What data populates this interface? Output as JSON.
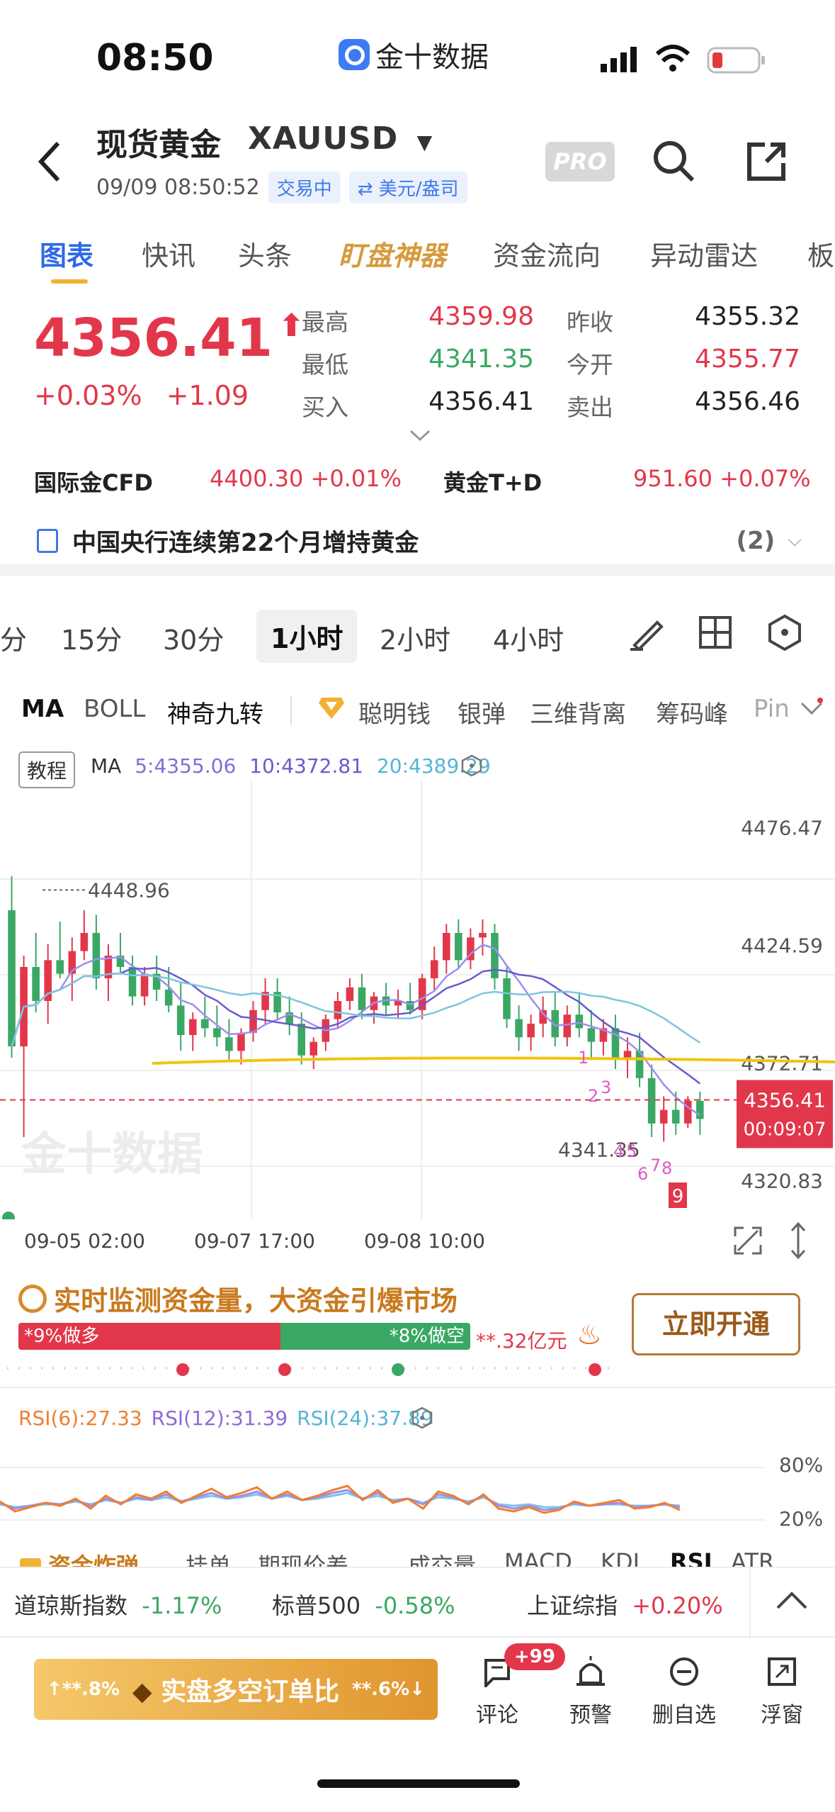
{
  "status": {
    "time": "08:50",
    "app_name": "金十数据"
  },
  "header": {
    "title": "现货黄金",
    "code": "XAUUSD",
    "datetime": "09/09 08:50:52",
    "trade_status": "交易中",
    "unit": "⇄ 美元/盎司",
    "pro_label": "PRO"
  },
  "tabs": [
    "图表",
    "快讯",
    "头条",
    "盯盘神器",
    "资金流向",
    "异动雷达",
    "板"
  ],
  "quote": {
    "price": "4356.41",
    "change_pct": "+0.03%",
    "change_abs": "+1.09",
    "high_label": "最高",
    "high": "4359.98",
    "low_label": "最低",
    "low": "4341.35",
    "bid_label": "买入",
    "bid": "4356.41",
    "prev_label": "昨收",
    "prev": "4355.32",
    "open_label": "今开",
    "open": "4355.77",
    "ask_label": "卖出",
    "ask": "4356.46"
  },
  "related": {
    "cfd_label": "国际金CFD",
    "cfd_value": "4400.30 +0.01%",
    "td_label": "黄金T+D",
    "td_value": "951.60 +0.07%"
  },
  "news": {
    "headline": "中国央行连续第22个月增持黄金",
    "count": "(2)"
  },
  "intervals": [
    "分",
    "15分",
    "30分",
    "1小时",
    "2小时",
    "4小时"
  ],
  "indicators": [
    "MA",
    "BOLL",
    "神奇九转",
    "聪明钱",
    "银弹",
    "三维背离",
    "筹码峰",
    "Pin"
  ],
  "chart_legend": {
    "tutorial": "教程",
    "ma_label": "MA",
    "ma5": "5:4355.06",
    "ma10": "10:4372.81",
    "ma20": "20:4389.29"
  },
  "chart_data": {
    "type": "candlestick",
    "title": "",
    "y_ticks": [
      "4476.47",
      "4424.59",
      "4372.71",
      "4320.83"
    ],
    "x_ticks": [
      "09-05 02:00",
      "09-07 17:00",
      "09-08 10:00"
    ],
    "ylim": [
      4310,
      4485
    ],
    "max_label": "4448.96",
    "min_label": "4341.35",
    "current_price": "4356.41",
    "countdown": "00:09:07",
    "support_level": 4375,
    "nine_turn_marks": [
      "1",
      "2",
      "3",
      "4",
      "5",
      "6",
      "7",
      "8",
      "9"
    ],
    "watermark": "金十数据",
    "candles": [
      [
        4440,
        4455,
        4375,
        4380
      ],
      [
        4380,
        4420,
        4340,
        4415
      ],
      [
        4415,
        4430,
        4395,
        4400
      ],
      [
        4400,
        4425,
        4390,
        4418
      ],
      [
        4418,
        4435,
        4410,
        4412
      ],
      [
        4412,
        4428,
        4400,
        4422
      ],
      [
        4422,
        4440,
        4418,
        4430
      ],
      [
        4430,
        4438,
        4405,
        4410
      ],
      [
        4410,
        4425,
        4400,
        4420
      ],
      [
        4420,
        4430,
        4412,
        4415
      ],
      [
        4415,
        4420,
        4398,
        4402
      ],
      [
        4402,
        4415,
        4398,
        4412
      ],
      [
        4412,
        4420,
        4400,
        4405
      ],
      [
        4405,
        4415,
        4395,
        4398
      ],
      [
        4398,
        4408,
        4378,
        4385
      ],
      [
        4385,
        4395,
        4378,
        4392
      ],
      [
        4392,
        4402,
        4384,
        4388
      ],
      [
        4388,
        4398,
        4380,
        4384
      ],
      [
        4384,
        4392,
        4374,
        4378
      ],
      [
        4378,
        4388,
        4372,
        4386
      ],
      [
        4386,
        4400,
        4382,
        4396
      ],
      [
        4396,
        4410,
        4390,
        4404
      ],
      [
        4404,
        4410,
        4392,
        4395
      ],
      [
        4395,
        4402,
        4385,
        4390
      ],
      [
        4390,
        4395,
        4372,
        4376
      ],
      [
        4376,
        4384,
        4370,
        4382
      ],
      [
        4382,
        4394,
        4378,
        4392
      ],
      [
        4392,
        4404,
        4388,
        4400
      ],
      [
        4400,
        4410,
        4396,
        4406
      ],
      [
        4406,
        4412,
        4392,
        4396
      ],
      [
        4396,
        4404,
        4390,
        4402
      ],
      [
        4402,
        4408,
        4394,
        4398
      ],
      [
        4398,
        4405,
        4392,
        4400
      ],
      [
        4400,
        4408,
        4394,
        4396
      ],
      [
        4396,
        4412,
        4392,
        4410
      ],
      [
        4410,
        4424,
        4404,
        4418
      ],
      [
        4418,
        4434,
        4412,
        4430
      ],
      [
        4430,
        4436,
        4414,
        4418
      ],
      [
        4418,
        4432,
        4414,
        4428
      ],
      [
        4428,
        4436,
        4420,
        4430
      ],
      [
        4430,
        4434,
        4405,
        4410
      ],
      [
        4410,
        4415,
        4388,
        4392
      ],
      [
        4392,
        4398,
        4378,
        4384
      ],
      [
        4384,
        4394,
        4378,
        4390
      ],
      [
        4390,
        4402,
        4384,
        4396
      ],
      [
        4396,
        4404,
        4380,
        4384
      ],
      [
        4384,
        4398,
        4380,
        4394
      ],
      [
        4394,
        4404,
        4384,
        4388
      ],
      [
        4388,
        4396,
        4374,
        4382
      ],
      [
        4382,
        4392,
        4376,
        4388
      ],
      [
        4388,
        4394,
        4370,
        4374
      ],
      [
        4374,
        4384,
        4366,
        4378
      ],
      [
        4378,
        4386,
        4362,
        4366
      ],
      [
        4366,
        4372,
        4340,
        4346
      ],
      [
        4346,
        4358,
        4338,
        4352
      ],
      [
        4352,
        4360,
        4341,
        4346
      ],
      [
        4346,
        4358,
        4344,
        4356
      ],
      [
        4356,
        4360,
        4341,
        4348
      ]
    ]
  },
  "money_banner": {
    "title": "实时监测资金量，大资金引爆市场",
    "long_label": "*9%做多",
    "short_label": "*8%做空",
    "amount": "**.32亿元",
    "cta": "立即开通",
    "long_ratio": 0.58
  },
  "rsi": {
    "rsi6": "RSI(6):27.33",
    "rsi12": "RSI(12):31.39",
    "rsi24": "RSI(24):37.89",
    "upper": "80%",
    "lower": "20%"
  },
  "lower_tabs": [
    "资金炸弹",
    "挂单",
    "期现价差",
    "成交量",
    "MACD",
    "KDJ",
    "RSI",
    "ATR"
  ],
  "indices": [
    {
      "name": "道琼斯指数",
      "value": "-1.17%"
    },
    {
      "name": "标普500",
      "value": "-0.58%"
    },
    {
      "name": "上证综指",
      "value": "+0.20%"
    }
  ],
  "bottom": {
    "left_pct": "↑**.8%",
    "center": "实盘多空订单比",
    "right_pct": "**.6%↓",
    "comment": "评论",
    "comment_badge": "+99",
    "alert": "预警",
    "remove": "删自选",
    "float": "浮窗"
  },
  "colors": {
    "up": "#e2374a",
    "down": "#3aa864",
    "accent": "#2e6ae6",
    "gold": "#f1c40f"
  }
}
